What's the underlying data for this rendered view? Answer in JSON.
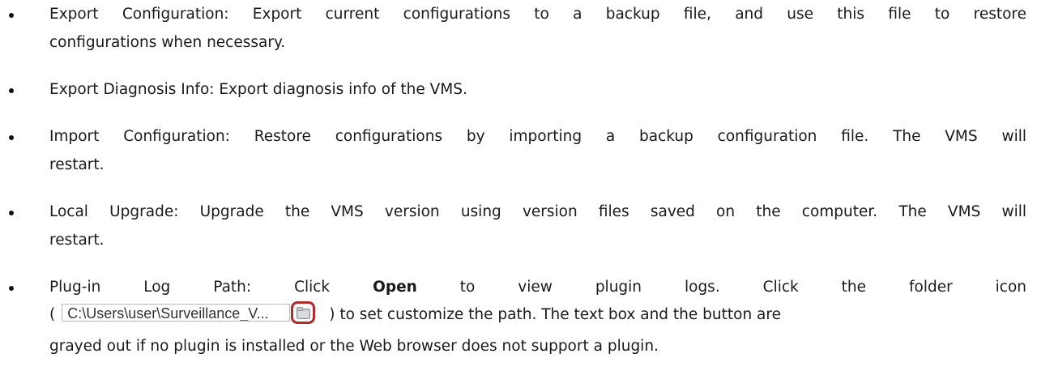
{
  "bullets": [
    {
      "lines": [
        "Export Configuration: Export current configurations to a backup file, and use this file to restore",
        "configurations when necessary."
      ]
    },
    {
      "lines": [
        "Export Diagnosis Info: Export diagnosis info of the VMS."
      ]
    },
    {
      "lines": [
        "Import Configuration: Restore configurations by importing a backup configuration file. The VMS will",
        "restart."
      ]
    },
    {
      "lines": [
        "Local Upgrade: Upgrade the VMS version using version files saved on the computer. The VMS will",
        "restart."
      ]
    }
  ],
  "plugin": {
    "line1_before_bold": "Plug-in Log Path: Click",
    "bold_open": "Open",
    "line1_after_bold": "to view plugin logs. Click the folder icon",
    "paren_open": "(",
    "path_value": "C:\\Users\\user\\Surveillance_V...",
    "folder_icon": "folder-icon",
    "line2_after": ") to set customize the path. The text box and the button are",
    "line3": "grayed out if no plugin is installed or the Web browser does not support a plugin."
  },
  "colors": {
    "highlight_border": "#b02a30"
  }
}
